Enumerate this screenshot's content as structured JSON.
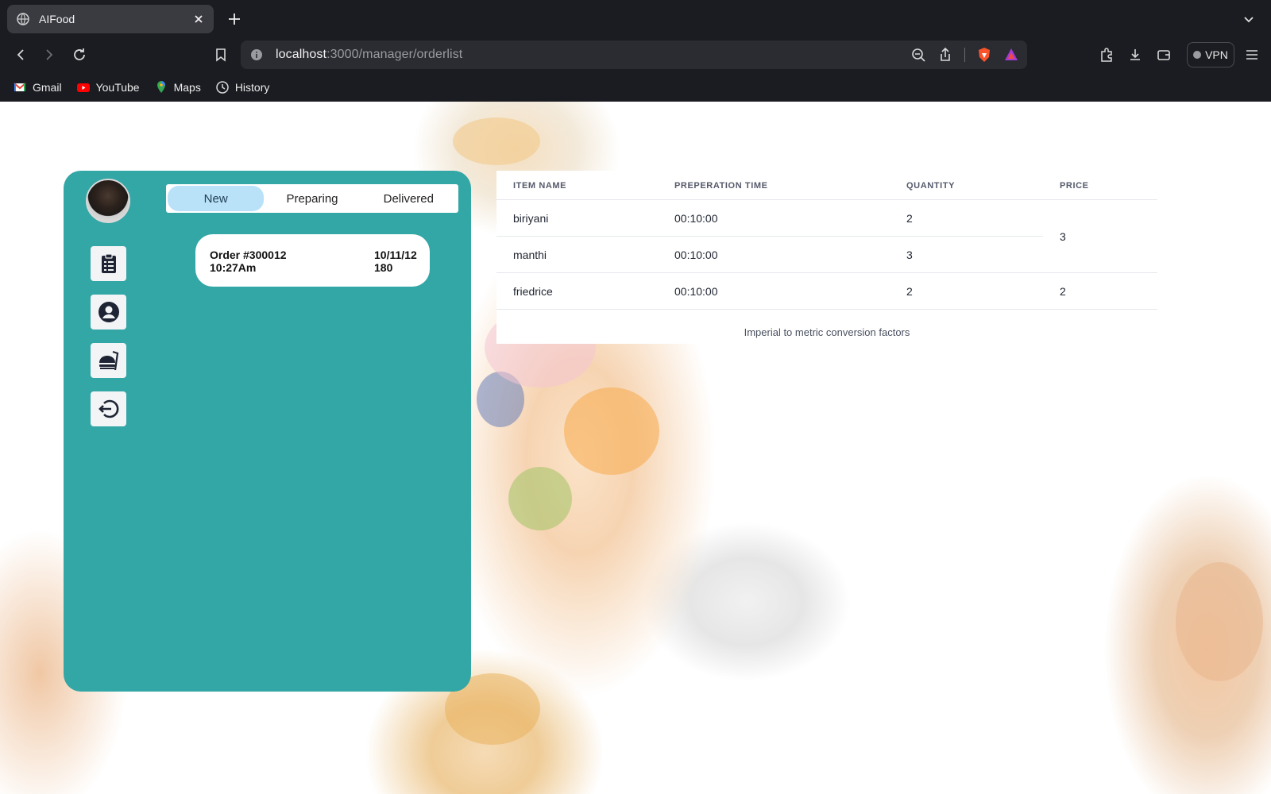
{
  "browser": {
    "tab_title": "AIFood",
    "url_host": "localhost",
    "url_path": ":3000/manager/orderlist",
    "vpn_label": "VPN",
    "bookmarks": [
      {
        "label": "Gmail",
        "icon": "gmail-icon"
      },
      {
        "label": "YouTube",
        "icon": "youtube-icon"
      },
      {
        "label": "Maps",
        "icon": "maps-icon"
      },
      {
        "label": "History",
        "icon": "history-icon"
      }
    ]
  },
  "sidebar": {
    "items": [
      {
        "icon": "clipboard-icon"
      },
      {
        "icon": "user-icon"
      },
      {
        "icon": "food-icon"
      },
      {
        "icon": "logout-icon"
      }
    ]
  },
  "status_tabs": [
    "New",
    "Preparing",
    "Delivered"
  ],
  "active_tab": "New",
  "order": {
    "number": "Order #300012",
    "time": "10:27Am",
    "date": "10/11/12",
    "total": "180"
  },
  "table": {
    "headers": [
      "ITEM NAME",
      "PREPERATION TIME",
      "QUANTITY",
      "PRICE"
    ],
    "rows": [
      {
        "item": "biriyani",
        "time": "00:10:00",
        "qty": "2"
      },
      {
        "item": "manthi",
        "time": "00:10:00",
        "qty": "3"
      },
      {
        "item": "friedrice",
        "time": "00:10:00",
        "qty": "2"
      }
    ],
    "prices": [
      "3",
      "2"
    ],
    "caption": "Imperial to metric conversion factors"
  },
  "colors": {
    "panel": "#33a6a6",
    "active_tab": "#b9e1f7",
    "browser_chrome": "#1b1c21"
  }
}
